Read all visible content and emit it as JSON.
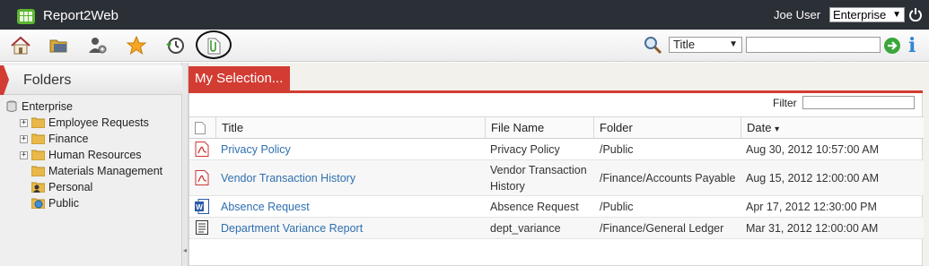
{
  "app": {
    "title": "Report2Web"
  },
  "header": {
    "user": "Joe User",
    "environment": "Enterprise"
  },
  "toolbar": {
    "buttons": [
      {
        "name": "home-icon"
      },
      {
        "name": "folders-icon"
      },
      {
        "name": "user-settings-icon"
      },
      {
        "name": "favorites-star-icon"
      },
      {
        "name": "history-icon"
      },
      {
        "name": "my-selection-clip-icon"
      }
    ],
    "search_field": "Title",
    "search_value": ""
  },
  "sidebar": {
    "title": "Folders",
    "root": "Enterprise",
    "items": [
      {
        "label": "Employee Requests",
        "expandable": true
      },
      {
        "label": "Finance",
        "expandable": true
      },
      {
        "label": "Human Resources",
        "expandable": true
      },
      {
        "label": "Materials Management",
        "expandable": false
      },
      {
        "label": "Personal",
        "expandable": false
      },
      {
        "label": "Public",
        "expandable": false
      }
    ]
  },
  "main": {
    "tab": "My Selection...",
    "filter_label": "Filter",
    "filter_value": "",
    "columns": [
      "Title",
      "File Name",
      "Folder",
      "Date"
    ],
    "sort_indicator": "▾",
    "rows": [
      {
        "type": "pdf",
        "title": "Privacy Policy",
        "file_name": "Privacy Policy",
        "folder": "/Public",
        "date": "Aug 30, 2012 10:57:00 AM"
      },
      {
        "type": "pdf",
        "title": "Vendor Transaction History",
        "file_name_line1": "Vendor Transaction",
        "file_name_line2": "History",
        "folder": "/Finance/Accounts Payable",
        "date": "Aug 15, 2012 12:00:00 AM"
      },
      {
        "type": "word",
        "title": "Absence Request",
        "file_name": "Absence Request",
        "folder": "/Public",
        "date": "Apr 17, 2012 12:30:00 PM"
      },
      {
        "type": "text",
        "title": "Department Variance Report",
        "file_name": "dept_variance",
        "folder": "/Finance/General Ledger",
        "date": "Mar 31, 2012 12:00:00 AM"
      }
    ]
  },
  "colors": {
    "accent": "#d23c32",
    "link": "#2f6fb0",
    "topbar": "#2b2f36"
  }
}
